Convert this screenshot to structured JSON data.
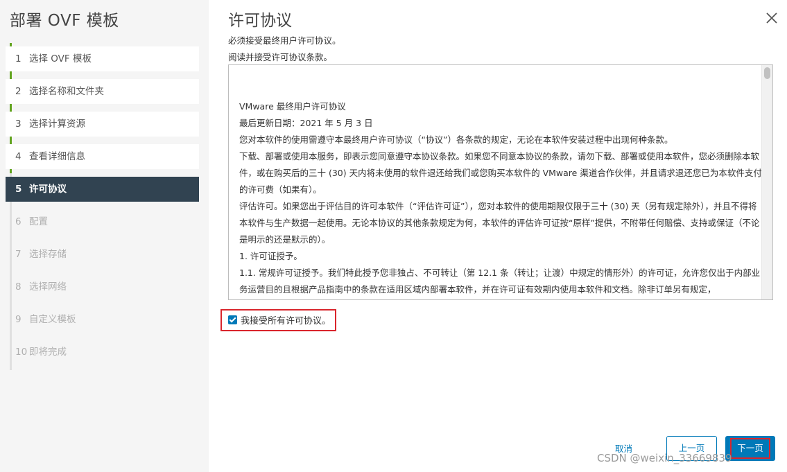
{
  "sidebar": {
    "title": "部署 OVF 模板",
    "steps": [
      {
        "num": "1",
        "label": "选择 OVF 模板",
        "state": "done"
      },
      {
        "num": "2",
        "label": "选择名称和文件夹",
        "state": "done"
      },
      {
        "num": "3",
        "label": "选择计算资源",
        "state": "done"
      },
      {
        "num": "4",
        "label": "查看详细信息",
        "state": "done"
      },
      {
        "num": "5",
        "label": "许可协议",
        "state": "active"
      },
      {
        "num": "6",
        "label": "配置",
        "state": "pending"
      },
      {
        "num": "7",
        "label": "选择存储",
        "state": "pending"
      },
      {
        "num": "8",
        "label": "选择网络",
        "state": "pending"
      },
      {
        "num": "9",
        "label": "自定义模板",
        "state": "pending"
      },
      {
        "num": "10",
        "label": "即将完成",
        "state": "pending"
      }
    ]
  },
  "main": {
    "title": "许可协议",
    "instruction_1": "必须接受最终用户许可协议。",
    "instruction_2": "阅读并接受许可协议条款。",
    "eula": {
      "lines": [
        "VMware 最终用户许可协议",
        "最后更新日期：2021 年 5 月 3 日",
        "您对本软件的使用需遵守本最终用户许可协议（“协议”）各条款的规定，无论在本软件安装过程中出现何种条款。",
        "下载、部署或使用本服务，即表示您同意遵守本协议条款。如果您不同意本协议的条款，请勿下载、部署或使用本软件，您必须删除本软件，或在购买后的三十 (30) 天内将未使用的软件退还给我们或您购买本软件的 VMware 渠道合作伙伴，并且请求退还您已为本软件支付的许可费（如果有）。",
        "评估许可。如果您出于评估目的许可本软件（“评估许可证”），您对本软件的使用期限仅限于三十 (30) 天（另有规定除外），并且不得将本软件与生产数据一起使用。无论本协议的其他条款规定为何，本软件的评估许可证按“原样”提供，不附带任何赔偿、支持或保证（不论是明示的还是默示的）。",
        "1. 许可证授予。",
        "1.1. 常规许可证授予。我们特此授予您非独占、不可转让（第 12.1 条（转让；让渡）中规定的情形外）的许可证，允许您仅出于内部业务运营目的且根据产品指南中的条款在适用区域内部署本软件，并在许可证有效期内使用本软件和文档。除非订单另有规定，"
      ]
    },
    "accept_label": "我接受所有许可协议。",
    "accept_checked": true
  },
  "footer": {
    "cancel": "取消",
    "back": "上一页",
    "next": "下一页",
    "watermark": "CSDN @weixin_33669839"
  },
  "colors": {
    "accent": "#0079b8",
    "active_step_bg": "#314351",
    "done_line": "#62a420",
    "highlight_red": "#d9252c"
  }
}
